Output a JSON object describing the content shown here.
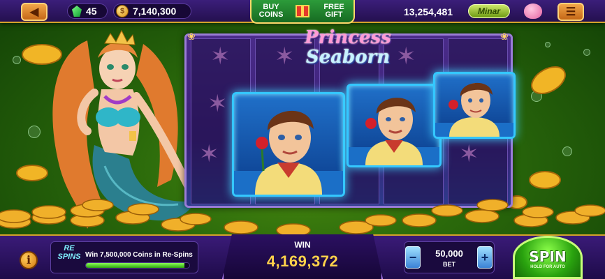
{
  "topbar": {
    "gems": "45",
    "coins": "7,140,300",
    "buy_coins": "BUY COINS",
    "free_gift": "FREE GIFT",
    "balance": "13,254,481",
    "minar": "Minar"
  },
  "game": {
    "title_line1": "Princess",
    "title_line2": "Seaborn"
  },
  "respin": {
    "logo_line1": "RE",
    "logo_line2": "SPINS",
    "message": "Win 7,500,000 Coins in Re-Spins",
    "progress": 0.95
  },
  "win": {
    "label": "WIN",
    "value": "4,169,372"
  },
  "bet": {
    "value": "50,000",
    "label": "BET",
    "minus": "−",
    "plus": "+"
  },
  "spin": {
    "label": "SPIN",
    "sub": "HOLD FOR AUTO"
  },
  "colors": {
    "accent_gold": "#d4a32a",
    "panel_purple": "#2b1061",
    "spin_green": "#2aa30f",
    "symbol_glow": "#34c7ff"
  },
  "icons": [
    "back-arrow-icon",
    "gem-icon",
    "coin-icon",
    "gift-icon",
    "piggy-bank-icon",
    "menu-icon",
    "info-icon",
    "minus-icon",
    "plus-icon"
  ]
}
